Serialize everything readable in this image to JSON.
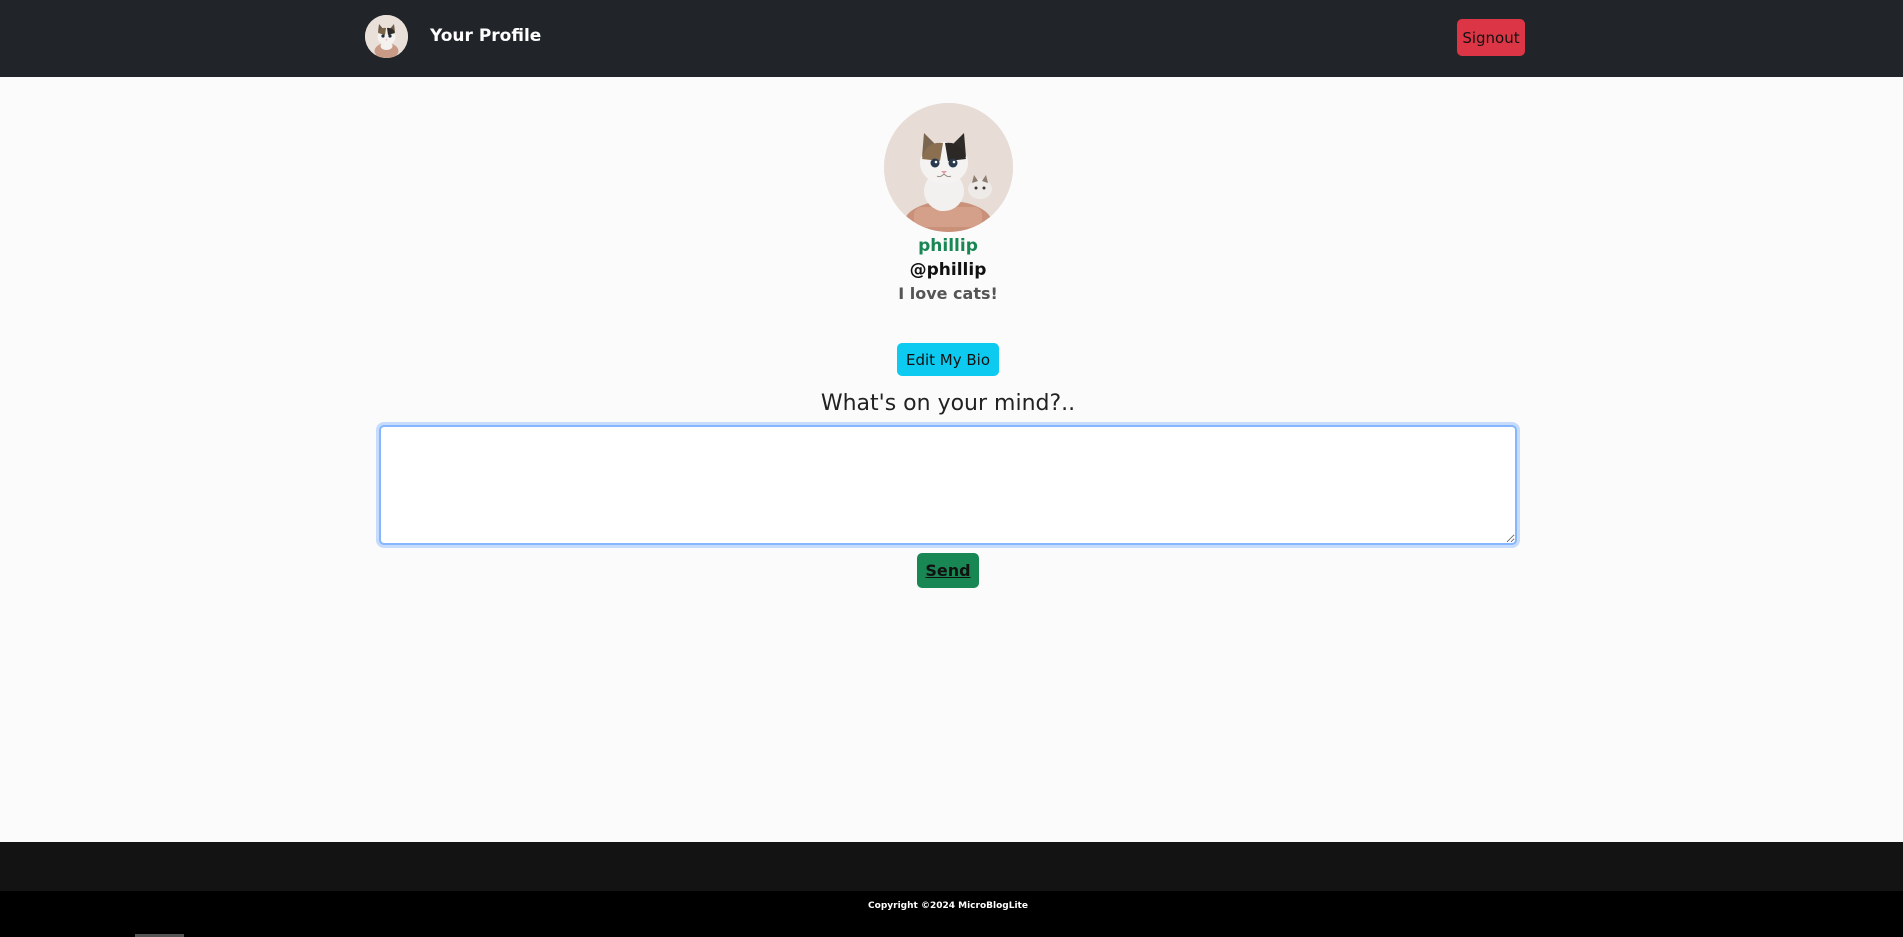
{
  "header": {
    "title": "Your Profile",
    "signout_label": "Signout",
    "avatar_icon": "cat-avatar-icon"
  },
  "profile": {
    "display_name": "phillip",
    "username": "@phillip",
    "bio": "I love cats!",
    "edit_bio_label": "Edit My Bio"
  },
  "composer": {
    "prompt": "What's on your mind?..",
    "value": "",
    "send_label": "Send"
  },
  "footer": {
    "copyright": "Copyright ©2024 MicroBlogLite"
  },
  "colors": {
    "navbar": "#212429",
    "signout": "#dc3545",
    "edit_bio": "#0dcaf0",
    "send": "#198754",
    "display_name": "#198754"
  }
}
